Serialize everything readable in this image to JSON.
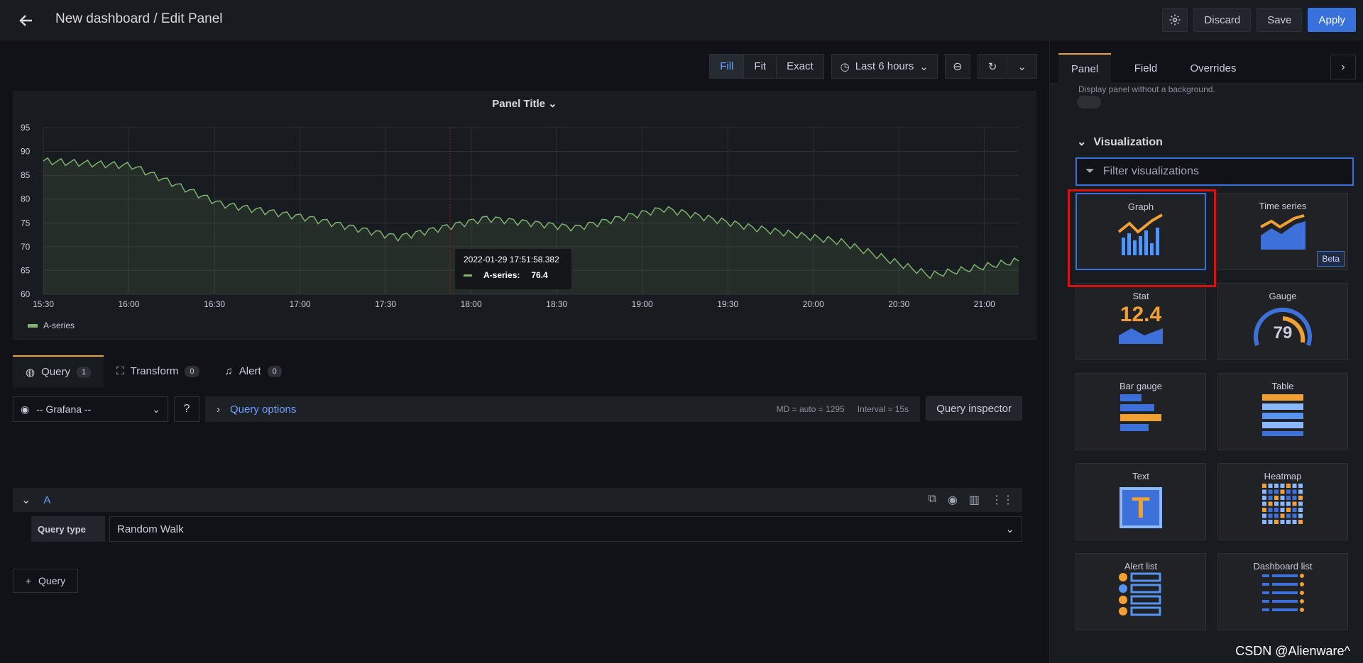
{
  "header": {
    "title": "New dashboard / Edit Panel",
    "discard": "Discard",
    "save": "Save",
    "apply": "Apply"
  },
  "toolbar": {
    "fill": "Fill",
    "fit": "Fit",
    "exact": "Exact",
    "time_range": "Last 6 hours"
  },
  "panel": {
    "title": "Panel Title",
    "legend": "A-series",
    "tooltip": {
      "time": "2022-01-29 17:51:58.382",
      "series": "A-series:",
      "value": "76.4"
    }
  },
  "chart_data": {
    "type": "line",
    "x": [
      "15:30",
      "16:00",
      "16:30",
      "17:00",
      "17:30",
      "18:00",
      "18:30",
      "19:00",
      "19:30",
      "20:00",
      "20:30",
      "21:00"
    ],
    "series": [
      {
        "name": "A-series",
        "values": [
          88,
          87,
          79,
          76,
          72,
          76,
          74,
          78,
          74,
          71,
          64,
          67
        ]
      }
    ],
    "yticks": [
      60,
      65,
      70,
      75,
      80,
      85,
      90,
      95
    ],
    "ylim": [
      60,
      95
    ]
  },
  "query_tabs": {
    "query": "Query",
    "query_count": "1",
    "transform": "Transform",
    "transform_count": "0",
    "alert": "Alert",
    "alert_count": "0"
  },
  "query": {
    "datasource": "-- Grafana --",
    "options": "Query options",
    "md": "MD = auto = 1295",
    "interval": "Interval = 15s",
    "inspector": "Query inspector",
    "ref": "A",
    "type_label": "Query type",
    "type_value": "Random Walk",
    "add": "Query"
  },
  "sidebar": {
    "tabs": [
      "Panel",
      "Field",
      "Overrides"
    ],
    "description": "Display panel without a background.",
    "section": "Visualization",
    "filter_placeholder": "Filter visualizations",
    "cards": [
      "Graph",
      "Time series",
      "Stat",
      "Gauge",
      "Bar gauge",
      "Table",
      "Text",
      "Heatmap",
      "Alert list",
      "Dashboard list"
    ],
    "beta": "Beta",
    "stat_value": "12.4",
    "gauge_value": "79",
    "text_glyph": "T"
  },
  "watermark": "CSDN @Alienware^",
  "colors": {
    "accent": "#3871dc",
    "series": "#7eb26d",
    "orange": "#f1a035",
    "red": "#d71212"
  }
}
